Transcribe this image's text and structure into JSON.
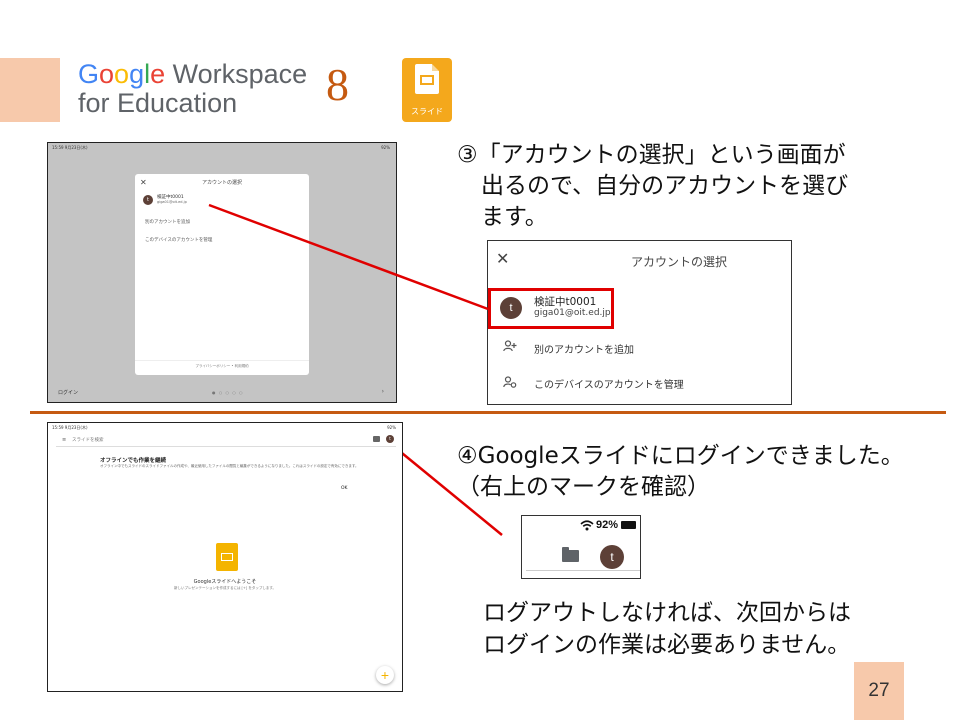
{
  "header": {
    "logo_line1_google": "Google",
    "logo_line1_rest": " Workspace",
    "logo_line2": "for Education",
    "step_number": "8",
    "app_icon_label": "スライド"
  },
  "colors": {
    "accent": "#c55a11",
    "deco": "#f7c9ab",
    "slides_yellow": "#f4a81c",
    "highlight_red": "#e00000",
    "avatar_brown": "#5d4037",
    "google_blue": "#4285f4",
    "google_red": "#ea4335",
    "google_yellow": "#fbbc05",
    "google_green": "#34a853"
  },
  "step3": {
    "line1": "③「アカウントの選択」という画面が",
    "line2": "出るので、自分のアカウントを選び",
    "line3": "ます。"
  },
  "shot1": {
    "status_left": "15:59  9月23日(木)",
    "status_right": "92%",
    "dialog_close": "✕",
    "dialog_title": "アカウントの選択",
    "avatar_letter": "t",
    "account_name": "検証中t0001",
    "account_email": "giga01@oit.ed.jp",
    "add_account": "別のアカウントを追加",
    "manage_accounts": "このデバイスのアカウントを管理",
    "footer": "プライバシーポリシー  •  利用規約",
    "login": "ログイン",
    "page_dots": "● ○ ○ ○ ○",
    "next": "›"
  },
  "zoom1": {
    "close": "✕",
    "title": "アカウントの選択",
    "avatar_letter": "t",
    "account_name": "検証中t0001",
    "account_email": "giga01@oit.ed.jp",
    "add_icon": "person-add-icon",
    "add_account": "別のアカウントを追加",
    "manage_icon": "manage-accounts-icon",
    "manage_accounts": "このデバイスのアカウントを管理"
  },
  "shot2": {
    "status_left": "15:59  9月23日(木)",
    "status_right": "92%",
    "menu_glyph": "≡",
    "search_placeholder": "スライドを検索",
    "avatar_letter": "t",
    "offline_title": "オフラインでも作業を継続",
    "offline_desc": "オフライン中でもスライドのスライドファイルの作成や、最近使用したファイルの閲覧と編集ができるようになりました。これはスライドの設定で有効にできます。",
    "ok": "OK",
    "welcome": "Googleスライドへようこそ",
    "welcome_sub": "新しいプレゼンテーションを作成するには [+] をタップします。",
    "fab": "+"
  },
  "step4": {
    "line1": "④Googleスライドにログインできました。",
    "line2": "（右上のマークを確認）"
  },
  "zoom2": {
    "wifi": "wifi-icon",
    "battery_pct": "92%",
    "avatar_letter": "t"
  },
  "note": {
    "line1": "ログアウトしなければ、次回からは",
    "line2": "ログインの作業は必要ありません。"
  },
  "page_number": "27"
}
